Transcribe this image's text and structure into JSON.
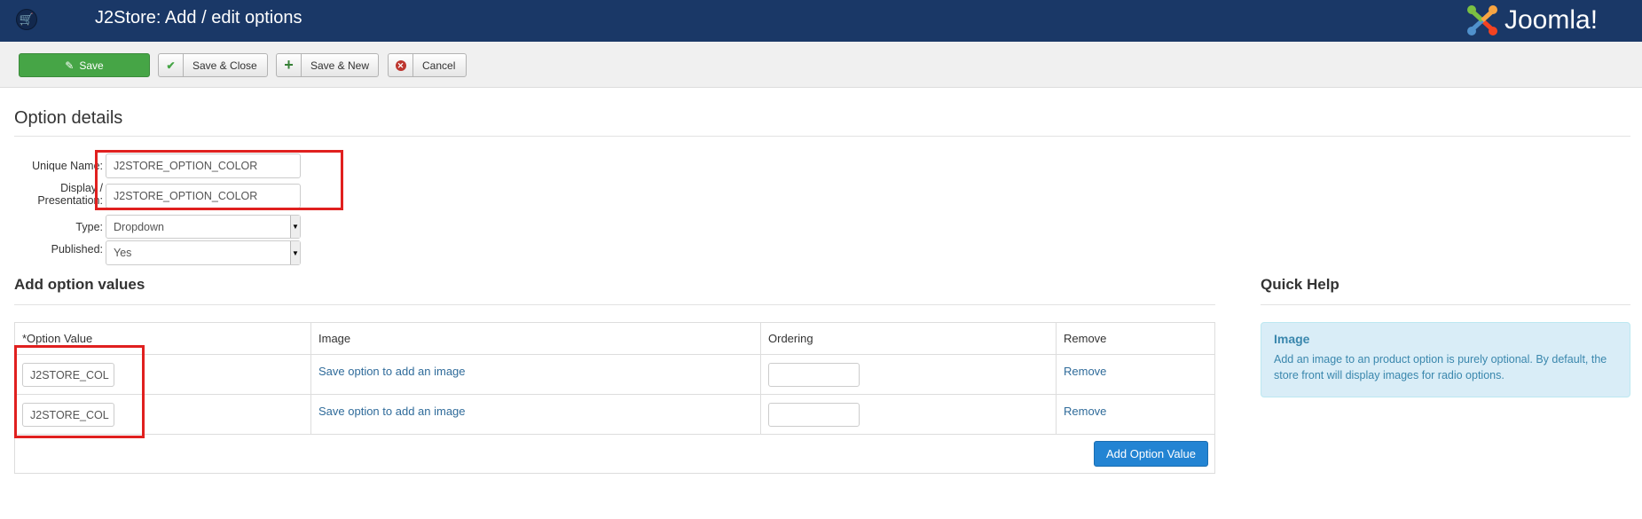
{
  "header": {
    "title": "J2Store: Add / edit options",
    "logo_text": "Joomla!",
    "logo_reg": "®"
  },
  "toolbar": {
    "save": "Save",
    "save_close": "Save & Close",
    "save_new": "Save & New",
    "cancel": "Cancel"
  },
  "details": {
    "heading": "Option details",
    "unique_name_label": "Unique Name:",
    "unique_name_value": "J2STORE_OPTION_COLOR",
    "display_label_1": "Display /",
    "display_label_2": "Presentation:",
    "display_value": "J2STORE_OPTION_COLOR",
    "type_label": "Type:",
    "type_value": "Dropdown",
    "published_label": "Published:",
    "published_value": "Yes"
  },
  "values": {
    "heading": "Add option values",
    "columns": [
      "*Option Value",
      "Image",
      "Ordering",
      "Remove"
    ],
    "rows": [
      {
        "value": "J2STORE_COL",
        "image": "Save option to add an image",
        "ordering": "",
        "remove": "Remove"
      },
      {
        "value": "J2STORE_COL",
        "image": "Save option to add an image",
        "ordering": "",
        "remove": "Remove"
      }
    ],
    "add_button": "Add Option Value"
  },
  "help": {
    "heading": "Quick Help",
    "title": "Image",
    "text": "Add an image to an product option is purely optional. By default, the store front will display images for radio options."
  },
  "colors": {
    "header": "#1a3867",
    "save": "#46a546",
    "primary": "#2384d3",
    "highlight": "#e0201f",
    "info_bg": "#d9edf7"
  }
}
